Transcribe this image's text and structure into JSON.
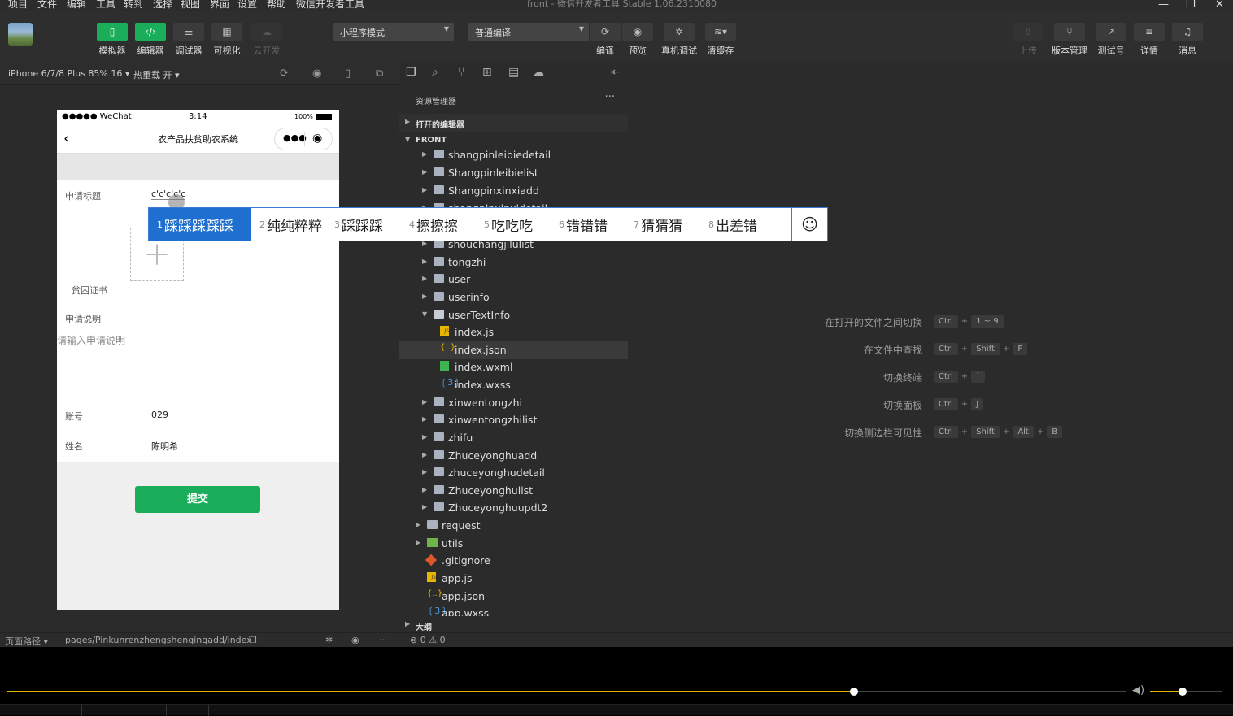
{
  "menubar": {
    "items": [
      "项目",
      "文件",
      "编辑",
      "工具",
      "转到",
      "选择",
      "视图",
      "界面",
      "设置",
      "帮助",
      "微信开发者工具"
    ],
    "window_title": "front - 微信开发者工具 Stable 1.06.2310080"
  },
  "toolbar": {
    "left_buttons": [
      {
        "label": "模拟器",
        "icon": "phone-icon"
      },
      {
        "label": "编辑器",
        "icon": "code-icon"
      },
      {
        "label": "调试器",
        "icon": "debug-sliders-icon"
      },
      {
        "label": "可视化",
        "icon": "layout-icon"
      },
      {
        "label": "云开发",
        "icon": "cloud-icon"
      }
    ],
    "mode_select": "小程序模式",
    "compile_select": "普通编译",
    "mid_buttons": [
      {
        "label": "编译",
        "icon": "refresh-icon"
      },
      {
        "label": "预览",
        "icon": "eye-icon"
      },
      {
        "label": "真机调试",
        "icon": "bug-icon"
      },
      {
        "label": "清缓存",
        "icon": "layers-icon"
      }
    ],
    "right_buttons": [
      {
        "label": "上传",
        "icon": "upload-icon"
      },
      {
        "label": "版本管理",
        "icon": "branch-icon"
      },
      {
        "label": "测试号",
        "icon": "external-link-icon"
      },
      {
        "label": "详情",
        "icon": "menu-icon"
      },
      {
        "label": "消息",
        "icon": "bell-icon"
      }
    ]
  },
  "simbar": {
    "device": "iPhone 6/7/8 Plus 85% 16",
    "hot_reload": "热重载 开"
  },
  "phone": {
    "status_left": "●●●●● WeChat",
    "status_time": "3:14",
    "status_battery": "100%",
    "nav_title": "农产品扶贫助农系统",
    "form": {
      "title_label": "申请标题",
      "title_value": "c'c'c'c'c",
      "cert_label": "贫困证书",
      "desc_label": "申请说明",
      "desc_placeholder": "请输入申请说明",
      "account_label": "账号",
      "account_value": "029",
      "name_label": "姓名",
      "name_value": "陈明希"
    },
    "submit_label": "提交"
  },
  "explorer": {
    "header": "资源管理器",
    "open_editors": "打开的编辑器",
    "project": "FRONT",
    "outline": "大纲",
    "tree": [
      {
        "name": "shangpinleibiedetail",
        "type": "folder",
        "depth": 1
      },
      {
        "name": "Shangpinleibielist",
        "type": "folder",
        "depth": 1
      },
      {
        "name": "Shangpinxinxiadd",
        "type": "folder",
        "depth": 1
      },
      {
        "name": "shangpinxinxidetail",
        "type": "folder",
        "depth": 1
      },
      {
        "name": "",
        "type": "hidden",
        "depth": 1
      },
      {
        "name": "",
        "type": "hidden",
        "depth": 1
      },
      {
        "name": "shouchangjilulist",
        "type": "folder",
        "depth": 1
      },
      {
        "name": "tongzhi",
        "type": "folder",
        "depth": 1
      },
      {
        "name": "user",
        "type": "folder",
        "depth": 1
      },
      {
        "name": "userinfo",
        "type": "folder",
        "depth": 1
      },
      {
        "name": "userTextInfo",
        "type": "folder-open",
        "depth": 1
      },
      {
        "name": "index.js",
        "type": "js",
        "depth": 2
      },
      {
        "name": "index.json",
        "type": "json",
        "depth": 2,
        "active": true
      },
      {
        "name": "index.wxml",
        "type": "wxml",
        "depth": 2
      },
      {
        "name": "index.wxss",
        "type": "wxss",
        "depth": 2
      },
      {
        "name": "xinwentongzhi",
        "type": "folder",
        "depth": 1
      },
      {
        "name": "xinwentongzhilist",
        "type": "folder",
        "depth": 1
      },
      {
        "name": "zhifu",
        "type": "folder",
        "depth": 1
      },
      {
        "name": "Zhuceyonghuadd",
        "type": "folder",
        "depth": 1
      },
      {
        "name": "zhuceyonghudetail",
        "type": "folder",
        "depth": 1
      },
      {
        "name": "Zhuceyonghulist",
        "type": "folder",
        "depth": 1
      },
      {
        "name": "Zhuceyonghuupdt2",
        "type": "folder",
        "depth": 1
      },
      {
        "name": "request",
        "type": "folder",
        "depth": 0
      },
      {
        "name": "utils",
        "type": "utils",
        "depth": 0
      },
      {
        "name": ".gitignore",
        "type": "git",
        "depth": 0
      },
      {
        "name": "app.js",
        "type": "js",
        "depth": 0
      },
      {
        "name": "app.json",
        "type": "json",
        "depth": 0
      },
      {
        "name": "app.wxss",
        "type": "wxss",
        "depth": 0
      }
    ]
  },
  "shortcuts": [
    {
      "action": "在打开的文件之间切换",
      "keys": [
        "Ctrl",
        "1 ~ 9"
      ]
    },
    {
      "action": "在文件中查找",
      "keys": [
        "Ctrl",
        "Shift",
        "F"
      ]
    },
    {
      "action": "切换终端",
      "keys": [
        "Ctrl",
        "`"
      ]
    },
    {
      "action": "切换面板",
      "keys": [
        "Ctrl",
        "J"
      ]
    },
    {
      "action": "切换侧边栏可见性",
      "keys": [
        "Ctrl",
        "Shift",
        "Alt",
        "B"
      ]
    }
  ],
  "ime": {
    "candidates": [
      {
        "n": "1",
        "text": "踩踩踩踩踩"
      },
      {
        "n": "2",
        "text": "纯纯粹粹"
      },
      {
        "n": "3",
        "text": "踩踩踩"
      },
      {
        "n": "4",
        "text": "擦擦擦"
      },
      {
        "n": "5",
        "text": "吃吃吃"
      },
      {
        "n": "6",
        "text": "错错错"
      },
      {
        "n": "7",
        "text": "猜猜猜"
      },
      {
        "n": "8",
        "text": "出差错"
      }
    ],
    "emoji": "☺"
  },
  "statusbar": {
    "path_label": "页面路径",
    "path": "pages/Pinkunrenzhengshenqingadd/index",
    "problems": "⊗ 0 ⚠ 0"
  },
  "video": {
    "progress": 0.757,
    "volume": 0.45
  },
  "colors": {
    "accent_green": "#1aad5a",
    "ime_blue": "#1f6fd1",
    "progress_yellow": "#e0b300"
  }
}
